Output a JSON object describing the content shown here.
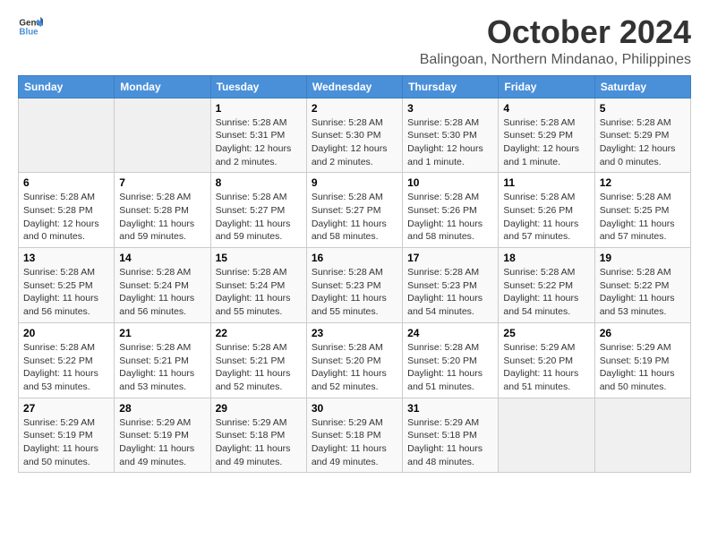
{
  "logo": {
    "line1": "General",
    "line2": "Blue"
  },
  "title": "October 2024",
  "location": "Balingoan, Northern Mindanao, Philippines",
  "days_header": [
    "Sunday",
    "Monday",
    "Tuesday",
    "Wednesday",
    "Thursday",
    "Friday",
    "Saturday"
  ],
  "weeks": [
    [
      {
        "day": "",
        "info": ""
      },
      {
        "day": "",
        "info": ""
      },
      {
        "day": "1",
        "info": "Sunrise: 5:28 AM\nSunset: 5:31 PM\nDaylight: 12 hours\nand 2 minutes."
      },
      {
        "day": "2",
        "info": "Sunrise: 5:28 AM\nSunset: 5:30 PM\nDaylight: 12 hours\nand 2 minutes."
      },
      {
        "day": "3",
        "info": "Sunrise: 5:28 AM\nSunset: 5:30 PM\nDaylight: 12 hours\nand 1 minute."
      },
      {
        "day": "4",
        "info": "Sunrise: 5:28 AM\nSunset: 5:29 PM\nDaylight: 12 hours\nand 1 minute."
      },
      {
        "day": "5",
        "info": "Sunrise: 5:28 AM\nSunset: 5:29 PM\nDaylight: 12 hours\nand 0 minutes."
      }
    ],
    [
      {
        "day": "6",
        "info": "Sunrise: 5:28 AM\nSunset: 5:28 PM\nDaylight: 12 hours\nand 0 minutes."
      },
      {
        "day": "7",
        "info": "Sunrise: 5:28 AM\nSunset: 5:28 PM\nDaylight: 11 hours\nand 59 minutes."
      },
      {
        "day": "8",
        "info": "Sunrise: 5:28 AM\nSunset: 5:27 PM\nDaylight: 11 hours\nand 59 minutes."
      },
      {
        "day": "9",
        "info": "Sunrise: 5:28 AM\nSunset: 5:27 PM\nDaylight: 11 hours\nand 58 minutes."
      },
      {
        "day": "10",
        "info": "Sunrise: 5:28 AM\nSunset: 5:26 PM\nDaylight: 11 hours\nand 58 minutes."
      },
      {
        "day": "11",
        "info": "Sunrise: 5:28 AM\nSunset: 5:26 PM\nDaylight: 11 hours\nand 57 minutes."
      },
      {
        "day": "12",
        "info": "Sunrise: 5:28 AM\nSunset: 5:25 PM\nDaylight: 11 hours\nand 57 minutes."
      }
    ],
    [
      {
        "day": "13",
        "info": "Sunrise: 5:28 AM\nSunset: 5:25 PM\nDaylight: 11 hours\nand 56 minutes."
      },
      {
        "day": "14",
        "info": "Sunrise: 5:28 AM\nSunset: 5:24 PM\nDaylight: 11 hours\nand 56 minutes."
      },
      {
        "day": "15",
        "info": "Sunrise: 5:28 AM\nSunset: 5:24 PM\nDaylight: 11 hours\nand 55 minutes."
      },
      {
        "day": "16",
        "info": "Sunrise: 5:28 AM\nSunset: 5:23 PM\nDaylight: 11 hours\nand 55 minutes."
      },
      {
        "day": "17",
        "info": "Sunrise: 5:28 AM\nSunset: 5:23 PM\nDaylight: 11 hours\nand 54 minutes."
      },
      {
        "day": "18",
        "info": "Sunrise: 5:28 AM\nSunset: 5:22 PM\nDaylight: 11 hours\nand 54 minutes."
      },
      {
        "day": "19",
        "info": "Sunrise: 5:28 AM\nSunset: 5:22 PM\nDaylight: 11 hours\nand 53 minutes."
      }
    ],
    [
      {
        "day": "20",
        "info": "Sunrise: 5:28 AM\nSunset: 5:22 PM\nDaylight: 11 hours\nand 53 minutes."
      },
      {
        "day": "21",
        "info": "Sunrise: 5:28 AM\nSunset: 5:21 PM\nDaylight: 11 hours\nand 53 minutes."
      },
      {
        "day": "22",
        "info": "Sunrise: 5:28 AM\nSunset: 5:21 PM\nDaylight: 11 hours\nand 52 minutes."
      },
      {
        "day": "23",
        "info": "Sunrise: 5:28 AM\nSunset: 5:20 PM\nDaylight: 11 hours\nand 52 minutes."
      },
      {
        "day": "24",
        "info": "Sunrise: 5:28 AM\nSunset: 5:20 PM\nDaylight: 11 hours\nand 51 minutes."
      },
      {
        "day": "25",
        "info": "Sunrise: 5:29 AM\nSunset: 5:20 PM\nDaylight: 11 hours\nand 51 minutes."
      },
      {
        "day": "26",
        "info": "Sunrise: 5:29 AM\nSunset: 5:19 PM\nDaylight: 11 hours\nand 50 minutes."
      }
    ],
    [
      {
        "day": "27",
        "info": "Sunrise: 5:29 AM\nSunset: 5:19 PM\nDaylight: 11 hours\nand 50 minutes."
      },
      {
        "day": "28",
        "info": "Sunrise: 5:29 AM\nSunset: 5:19 PM\nDaylight: 11 hours\nand 49 minutes."
      },
      {
        "day": "29",
        "info": "Sunrise: 5:29 AM\nSunset: 5:18 PM\nDaylight: 11 hours\nand 49 minutes."
      },
      {
        "day": "30",
        "info": "Sunrise: 5:29 AM\nSunset: 5:18 PM\nDaylight: 11 hours\nand 49 minutes."
      },
      {
        "day": "31",
        "info": "Sunrise: 5:29 AM\nSunset: 5:18 PM\nDaylight: 11 hours\nand 48 minutes."
      },
      {
        "day": "",
        "info": ""
      },
      {
        "day": "",
        "info": ""
      }
    ]
  ]
}
